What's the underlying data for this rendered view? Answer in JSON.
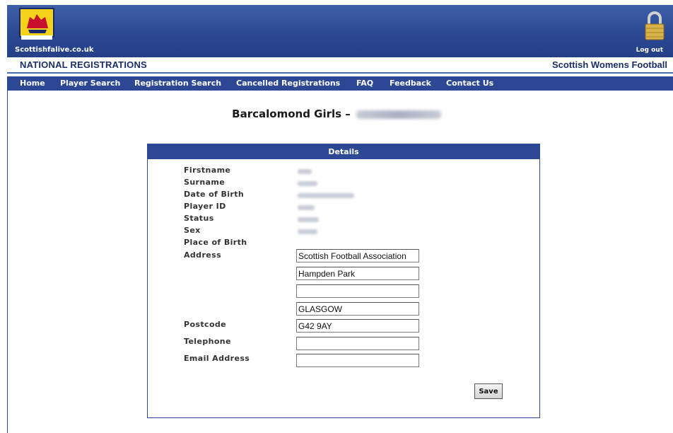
{
  "header": {
    "site_name": "Scottishfalive.co.uk",
    "logout_label": "Log out",
    "section_title": "NATIONAL REGISTRATIONS",
    "org_title": "Scottish Womens Football",
    "colors": {
      "banner": "#2c4894",
      "nav": "#2c4894",
      "text_dark": "#1b2f66"
    }
  },
  "nav": {
    "items": [
      {
        "label": "Home"
      },
      {
        "label": "Player Search"
      },
      {
        "label": "Registration Search"
      },
      {
        "label": "Cancelled Registrations"
      },
      {
        "label": "FAQ"
      },
      {
        "label": "Feedback"
      },
      {
        "label": "Contact Us"
      }
    ]
  },
  "page": {
    "title": "Barcalomond Girls –"
  },
  "details": {
    "heading": "Details",
    "labels": {
      "firstname": "Firstname",
      "surname": "Surname",
      "dob": "Date of Birth",
      "player_id": "Player ID",
      "status": "Status",
      "sex": "Sex",
      "place_of_birth": "Place of Birth",
      "address": "Address",
      "postcode": "Postcode",
      "telephone": "Telephone",
      "email": "Email Address"
    },
    "address_lines": [
      "Scottish Football Association",
      "Hampden Park",
      "",
      "GLASGOW"
    ],
    "postcode": "G42 9AY",
    "telephone": "",
    "email": "",
    "save_label": "Save"
  }
}
